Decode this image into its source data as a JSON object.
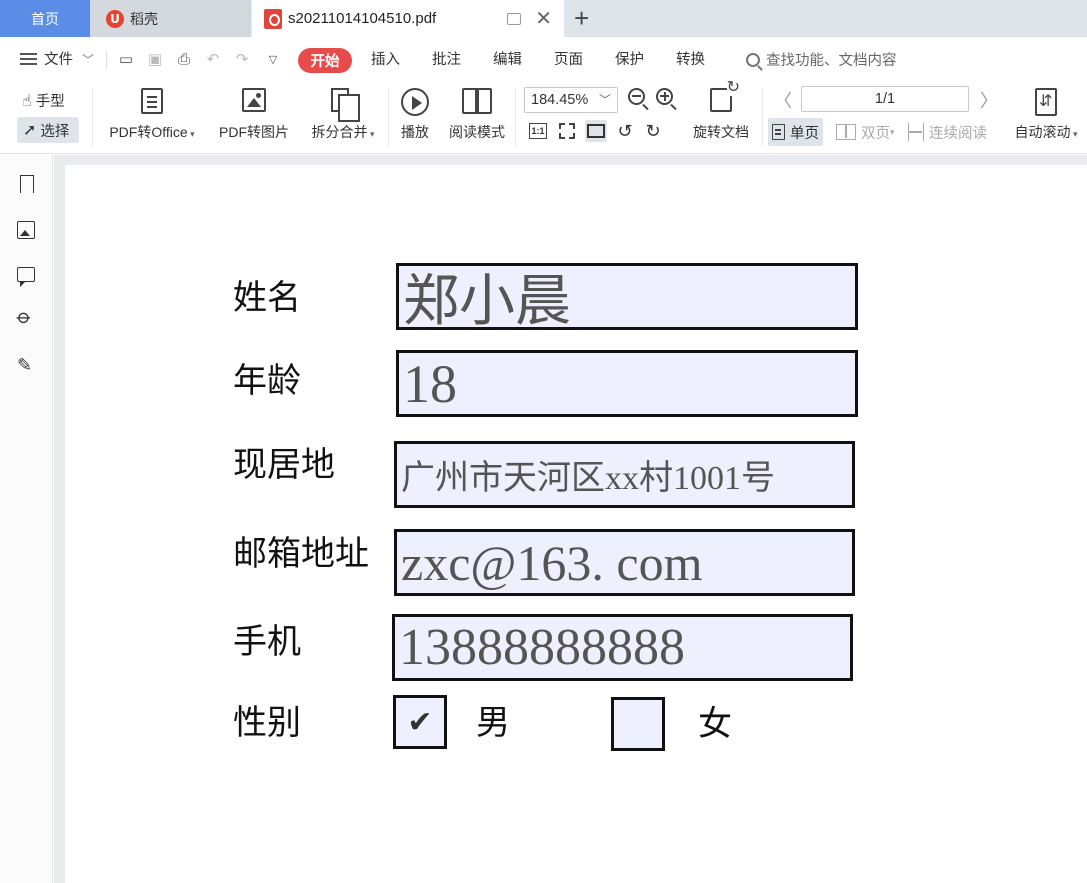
{
  "tabs": {
    "home": "首页",
    "daoke": "稻壳",
    "file": "s20211014104510.pdf"
  },
  "menu": {
    "file": "文件",
    "start": "开始",
    "insert": "插入",
    "annotate": "批注",
    "edit": "编辑",
    "page": "页面",
    "protect": "保护",
    "convert": "转换",
    "search_placeholder": "查找功能、文档内容"
  },
  "toolbar": {
    "hand": "手型",
    "select": "选择",
    "pdf_to_office": "PDF转Office",
    "pdf_to_image": "PDF转图片",
    "split_merge": "拆分合并",
    "play": "播放",
    "read_mode": "阅读模式",
    "zoom": "184.45%",
    "rotate_doc": "旋转文档",
    "page_indicator": "1/1",
    "single_page": "单页",
    "double_page": "双页",
    "continuous": "连续阅读",
    "auto_scroll": "自动滚动",
    "fit_label": "1:1"
  },
  "form": {
    "name_label": "姓名",
    "name_value": "郑小晨",
    "age_label": "年龄",
    "age_value": "18",
    "address_label": "现居地",
    "address_value": "广州市天河区xx村1001号",
    "email_label": "邮箱地址",
    "email_value": "zxc@163. com",
    "phone_label": "手机",
    "phone_value": "13888888888",
    "gender_label": "性别",
    "male_label": "男",
    "female_label": "女",
    "male_checked": true,
    "female_checked": false,
    "check_mark": "✔"
  }
}
